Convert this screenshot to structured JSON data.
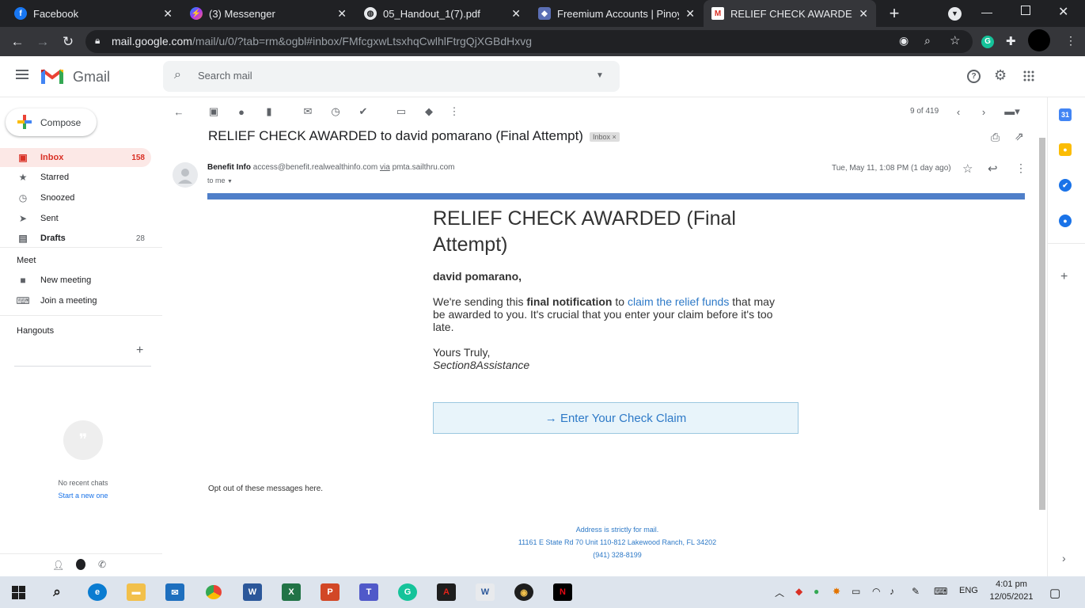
{
  "browser": {
    "tabs": [
      {
        "title": "Facebook",
        "icon": "facebook-icon",
        "active": false
      },
      {
        "title": "(3) Messenger",
        "icon": "messenger-icon",
        "active": false
      },
      {
        "title": "05_Handout_1(7).pdf",
        "icon": "globe-icon",
        "active": false
      },
      {
        "title": "Freemium Accounts | Pinoy In",
        "icon": "site-shield-icon",
        "active": false
      },
      {
        "title": "RELIEF CHECK AWARDED to d",
        "icon": "gmail-icon",
        "active": true
      }
    ],
    "url_host": "mail.google.com",
    "url_path": "/mail/u/0/?tab=rm&ogbl#inbox/FMfcgxwLtsxhqCwlhlFtrgQjXGBdHxvg",
    "new_tab": "+"
  },
  "gmail": {
    "logo_text": "Gmail",
    "search_placeholder": "Search mail",
    "compose_label": "Compose",
    "nav": [
      {
        "label": "Inbox",
        "count": "158",
        "icon": "inbox-icon"
      },
      {
        "label": "Starred",
        "count": "",
        "icon": "star-icon"
      },
      {
        "label": "Snoozed",
        "count": "",
        "icon": "clock-icon"
      },
      {
        "label": "Sent",
        "count": "",
        "icon": "send-icon"
      },
      {
        "label": "Drafts",
        "count": "28",
        "icon": "draft-icon"
      }
    ],
    "meet_header": "Meet",
    "meet_items": [
      {
        "label": "New meeting",
        "icon": "video-icon"
      },
      {
        "label": "Join a meeting",
        "icon": "keyboard-icon"
      }
    ],
    "hangouts_header": "Hangouts",
    "no_chats": "No recent chats",
    "start_new": "Start a new one",
    "pagination": "9 of 419"
  },
  "message": {
    "subject": "RELIEF CHECK AWARDED to david pomarano (Final Attempt)",
    "label_chip": "Inbox",
    "label_close": "×",
    "sender_name": "Benefit Info",
    "sender_email": "access@benefit.realwealthinfo.com",
    "via_word": "via",
    "via_domain": "pmta.sailthru.com",
    "to_me": "to me",
    "date": "Tue, May 11, 1:08 PM (1 day ago)",
    "heading": "RELIEF CHECK AWARDED (Final Attempt)",
    "greeting": "david pomarano,",
    "body_pre": "We're sending this ",
    "body_bold": "final notification",
    "body_mid": " to ",
    "body_link": "claim the relief funds",
    "body_post": " that may be awarded to you. It's crucial that you enter your claim before it's too late.",
    "sign_1": "Yours Truly,",
    "sign_2": "Section8Assistance",
    "cta": "→ Enter Your Check Claim",
    "optout": "Opt out of these messages here.",
    "footer_1": "Address is strictly for mail.",
    "footer_2": "11161 E State Rd 70 Unit 110-812 Lakewood Ranch, FL 34202",
    "footer_3": "(941) 328-8199"
  },
  "taskbar": {
    "language": "ENG",
    "time": "4:01 pm",
    "date": "12/05/2021"
  },
  "colors": {
    "gmail_red": "#d93025",
    "link_blue": "#2d79c7",
    "email_bar": "#4f7fc9",
    "chrome_dark": "#202124"
  }
}
